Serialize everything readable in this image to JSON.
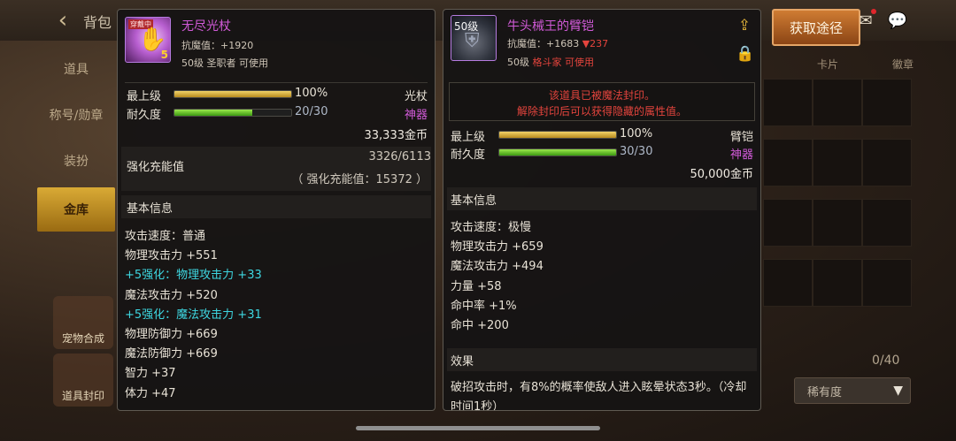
{
  "background": {
    "back_icon": "back-arrow-icon",
    "title": "背包",
    "side_tabs": [
      "道具",
      "称号/勋章",
      "装扮",
      "金库"
    ],
    "active_tab": "金库",
    "features": [
      "宠物合成",
      "道具封印"
    ],
    "grid_tabs": [
      "",
      "卡片",
      "徽章"
    ],
    "capacity": "0/40",
    "rarity_select": "稀有度",
    "acquire_button": "获取途径"
  },
  "left_item": {
    "icon_tag": "穿戴中",
    "icon_level": "5",
    "name": "无尽光杖",
    "anti_magic_label": "抗魔值：",
    "anti_magic_value": "+1920",
    "requirement": "50级 圣职者 可使用",
    "level_label": "最上级",
    "level_percent": "100%",
    "level_fill": 1.0,
    "weapon_type": "光杖",
    "durability_label": "耐久度",
    "durability_value": "20/30",
    "durability_fill": 0.667,
    "grade": "神器",
    "price": "33,333金币",
    "charge_label": "强化充能值",
    "charge_value": "3326/6113",
    "charge_detail": "（ 强化充能值：15372 ）",
    "basic_info_label": "基本信息",
    "stats": [
      {
        "text": "攻击速度：普通",
        "highlight": false
      },
      {
        "text": "物理攻击力 +551",
        "highlight": false
      },
      {
        "text": "+5强化：物理攻击力 +33",
        "highlight": true
      },
      {
        "text": "魔法攻击力 +520",
        "highlight": false
      },
      {
        "text": "+5强化：魔法攻击力 +31",
        "highlight": true
      },
      {
        "text": "物理防御力 +669",
        "highlight": false
      },
      {
        "text": "魔法防御力 +669",
        "highlight": false
      },
      {
        "text": "智力 +37",
        "highlight": false
      },
      {
        "text": "体力 +47",
        "highlight": false
      }
    ]
  },
  "right_item": {
    "icon_tag": "50级",
    "name": "牛头械王的臂铠",
    "anti_magic_label": "抗魔值：",
    "anti_magic_value": "+1683",
    "anti_magic_delta": "▼237",
    "requirement_level": "50级",
    "requirement_class": "格斗家 可使用",
    "seal_line1": "该道具已被魔法封印。",
    "seal_line2": "解除封印后可以获得隐藏的属性值。",
    "level_label": "最上级",
    "level_percent": "100%",
    "level_fill": 1.0,
    "armor_type": "臂铠",
    "durability_label": "耐久度",
    "durability_value": "30/30",
    "durability_fill": 1.0,
    "grade": "神器",
    "price": "50,000金币",
    "basic_info_label": "基本信息",
    "stats": [
      "攻击速度：极慢",
      "物理攻击力 +659",
      "魔法攻击力 +494",
      "力量 +58",
      "命中率 +1%",
      "命中 +200"
    ],
    "effect_label": "效果",
    "effect_text": "破招攻击时，有8%的概率使敌人进入眩晕状态3秒。（冷却时间1秒）",
    "share_icon": "share-icon",
    "lock_icon": "lock-icon"
  }
}
